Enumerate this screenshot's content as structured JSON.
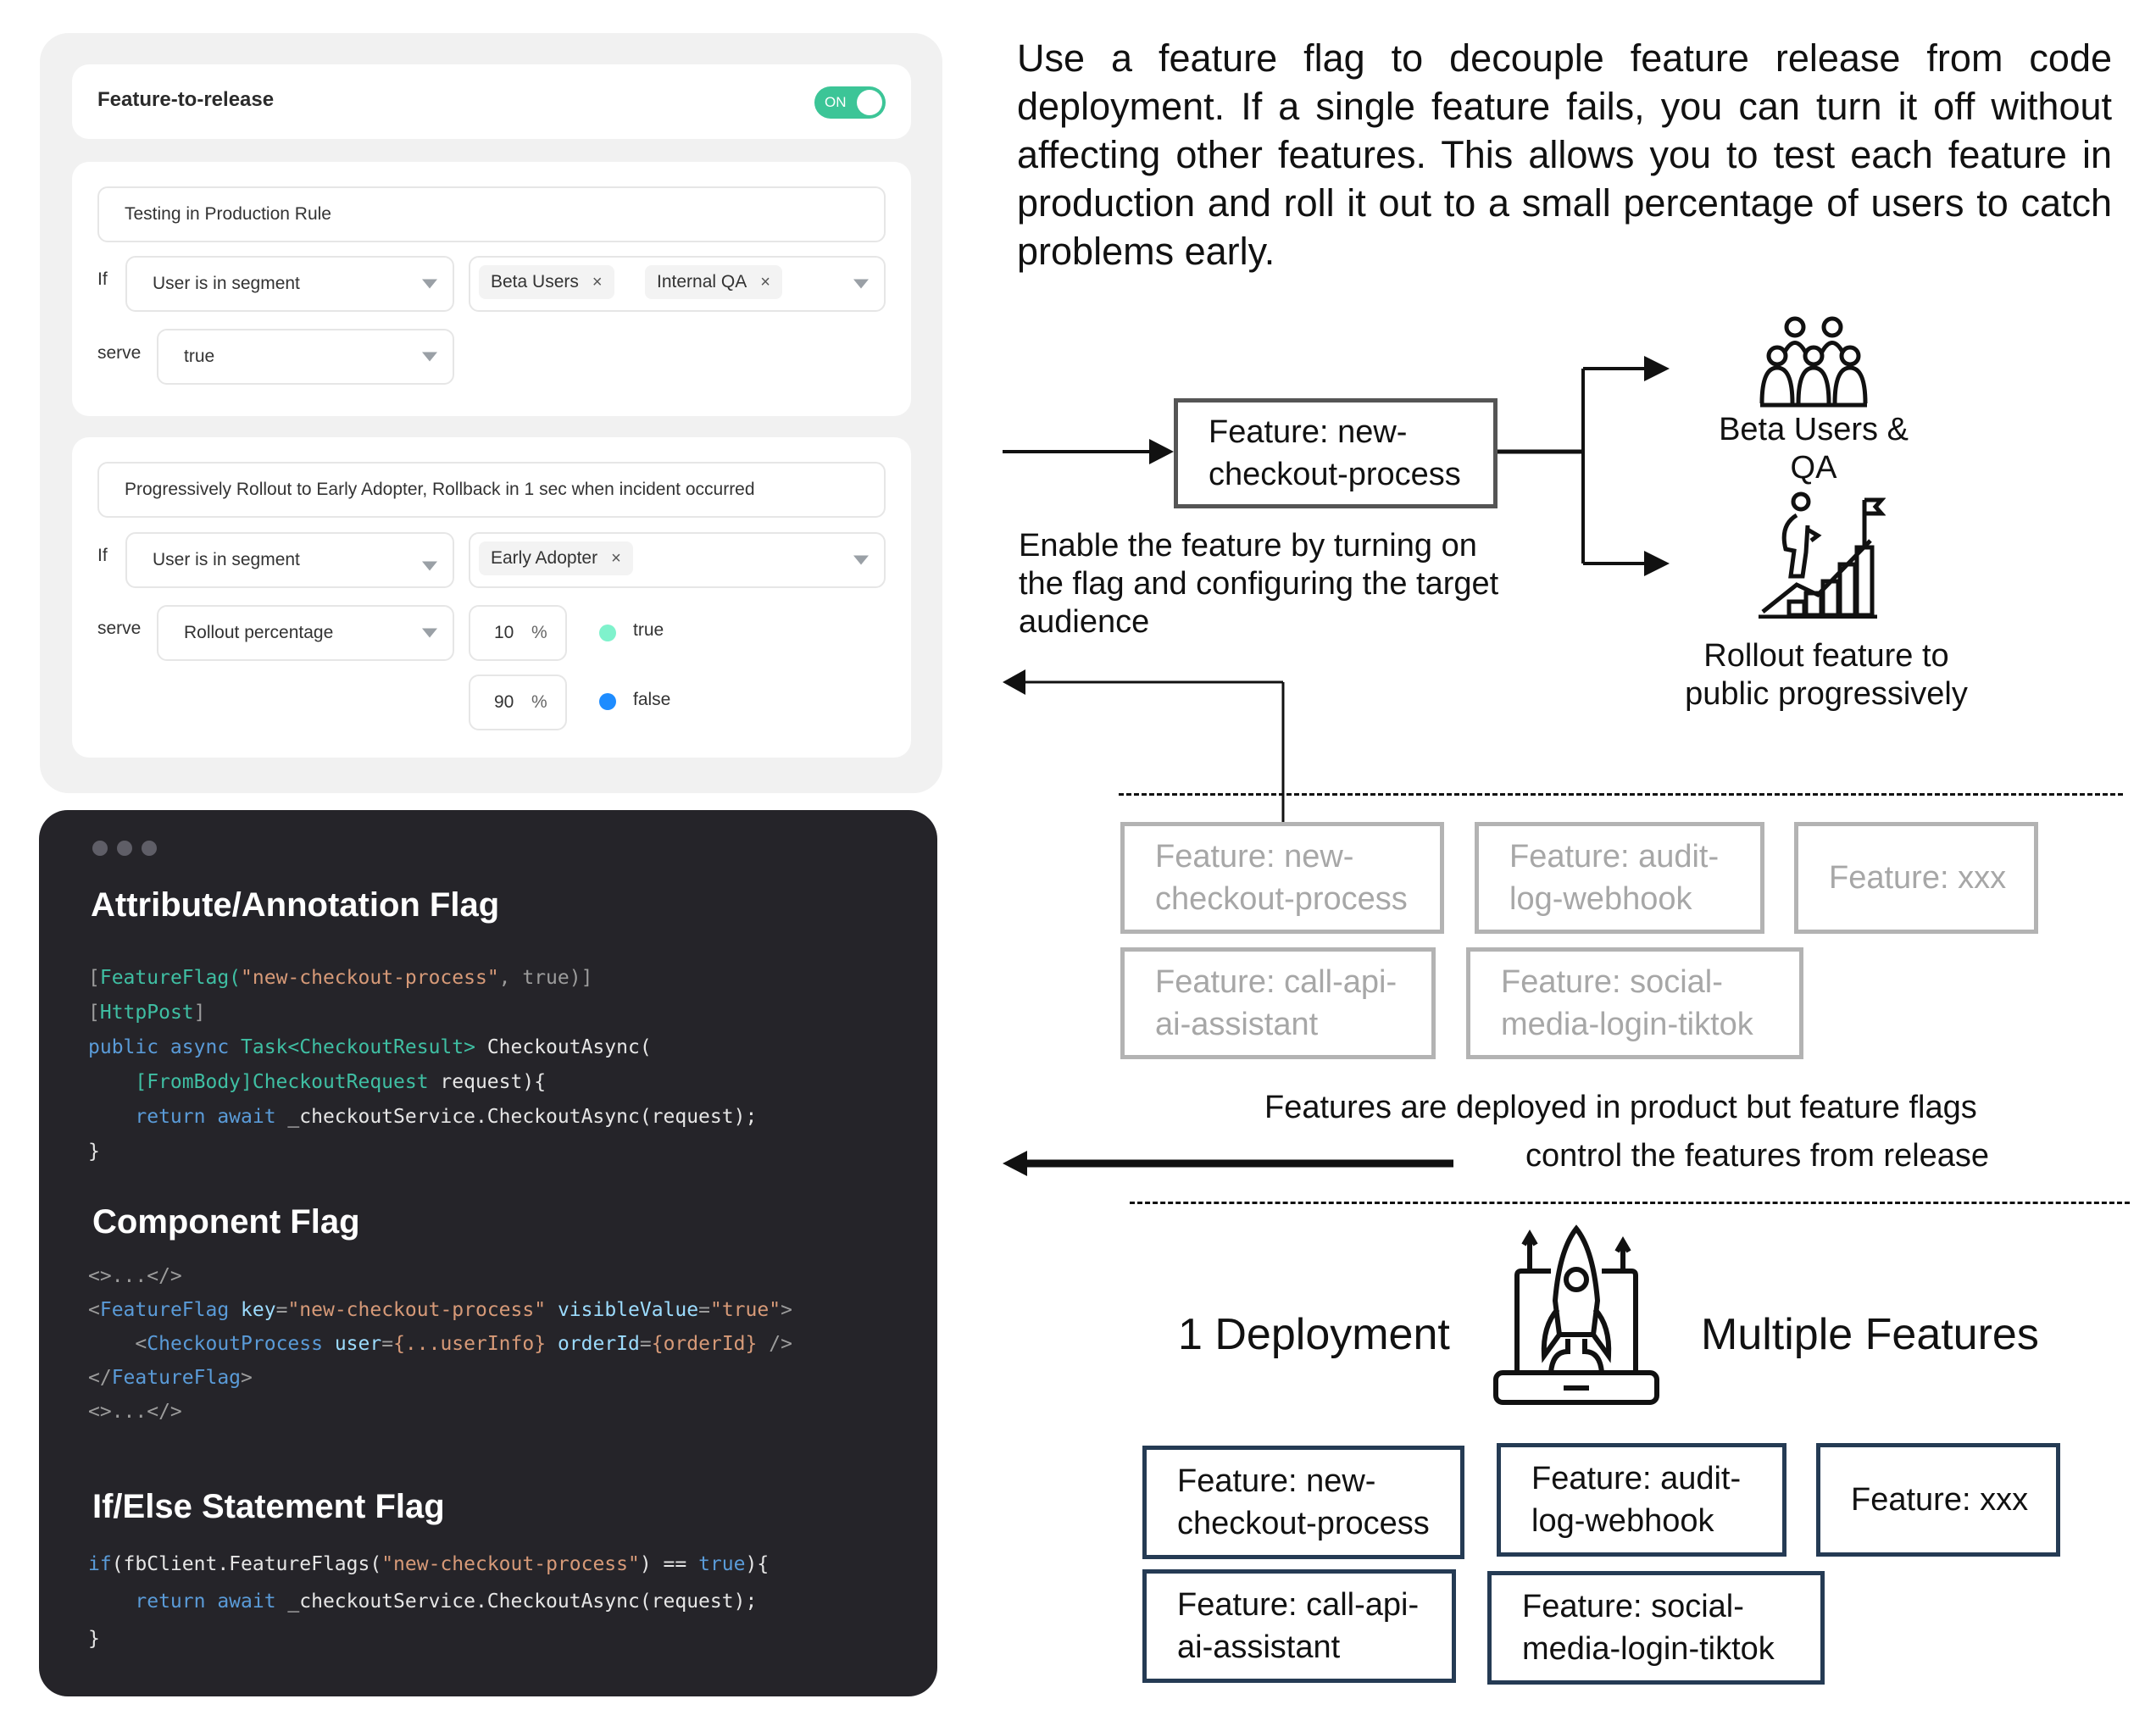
{
  "settings_panel": {
    "flag_name": "Feature-to-release",
    "toggle": {
      "label": "ON",
      "state": "on",
      "color": "#3cc597"
    },
    "rules": [
      {
        "name": "Testing in Production Rule",
        "if_label": "If",
        "condition": "User is in segment",
        "segments": [
          "Beta Users",
          "Internal QA"
        ],
        "serve_label": "serve",
        "serve_value": "true"
      },
      {
        "name": "Progressively Rollout to Early Adopter, Rollback in 1 sec when incident occurred",
        "if_label": "If",
        "condition": "User is in segment",
        "segments": [
          "Early Adopter"
        ],
        "serve_label": "serve",
        "serve_value": "Rollout percentage",
        "rollout": [
          {
            "percent": "10",
            "unit": "%",
            "variation": "true",
            "color": "#7ff2cc"
          },
          {
            "percent": "90",
            "unit": "%",
            "variation": "false",
            "color": "#1e8cff"
          }
        ]
      }
    ],
    "remove_glyph": "×"
  },
  "code_panel": {
    "sections": [
      {
        "title": "Attribute/Annotation Flag",
        "lines": [
          [
            [
              "g",
              "["
            ],
            [
              "t",
              "FeatureFlag("
            ],
            [
              "s",
              "\"new-checkout-process\""
            ],
            [
              "g",
              ", true)]"
            ]
          ],
          [
            [
              "g",
              "["
            ],
            [
              "t",
              "HttpPost"
            ],
            [
              "g",
              "]"
            ]
          ],
          [
            [
              "k",
              "public async "
            ],
            [
              "t",
              "Task<CheckoutResult> "
            ],
            [
              "w",
              "CheckoutAsync("
            ]
          ],
          [
            [
              "w",
              "    "
            ],
            [
              "t",
              "[FromBody]CheckoutRequest "
            ],
            [
              "w",
              "request){"
            ]
          ],
          [
            [
              "w",
              "    "
            ],
            [
              "k",
              "return await "
            ],
            [
              "w",
              "_checkoutService.CheckoutAsync(request);"
            ]
          ],
          [
            [
              "w",
              "}"
            ]
          ]
        ]
      },
      {
        "title": "Component Flag",
        "lines": [
          [
            [
              "g",
              "<>...</>"
            ]
          ],
          [
            [
              "g",
              "<"
            ],
            [
              "k",
              "FeatureFlag "
            ],
            [
              "a",
              "key"
            ],
            [
              "g",
              "="
            ],
            [
              "s",
              "\"new-checkout-process\" "
            ],
            [
              "a",
              "visibleValue"
            ],
            [
              "g",
              "="
            ],
            [
              "s",
              "\"true\""
            ],
            [
              "g",
              ">"
            ]
          ],
          [
            [
              "g",
              "    <"
            ],
            [
              "k",
              "CheckoutProcess "
            ],
            [
              "a",
              "user"
            ],
            [
              "g",
              "="
            ],
            [
              "s",
              "{...userInfo} "
            ],
            [
              "a",
              "orderId"
            ],
            [
              "g",
              "="
            ],
            [
              "s",
              "{orderId} "
            ],
            [
              "g",
              "/>"
            ]
          ],
          [
            [
              "g",
              "</"
            ],
            [
              "k",
              "FeatureFlag"
            ],
            [
              "g",
              ">"
            ]
          ],
          [
            [
              "g",
              "<>...</>"
            ]
          ]
        ]
      },
      {
        "title": "If/Else Statement Flag",
        "lines": [
          [
            [
              "k",
              "if"
            ],
            [
              "w",
              "(fbClient.FeatureFlags("
            ],
            [
              "s",
              "\"new-checkout-process\""
            ],
            [
              "w",
              ") == "
            ],
            [
              "k",
              "true"
            ],
            [
              "w",
              "){"
            ]
          ],
          [
            [
              "w",
              "    "
            ],
            [
              "k",
              "return await "
            ],
            [
              "w",
              "_checkoutService.CheckoutAsync(request);"
            ]
          ],
          [
            [
              "w",
              "}"
            ]
          ]
        ]
      }
    ]
  },
  "diagram": {
    "intro": "Use a feature flag to decouple feature release from code deployment. If a single feature fails, you can turn it off without affecting other features. This allows you to test each feature in production and roll it out to a small percentage of users to catch problems early.",
    "main_feature": "Feature: new-checkout-process",
    "enable_caption": "Enable the feature by turning on the flag and configuring the target audience",
    "targets": [
      {
        "label": "Beta Users & QA",
        "icon": "group-of-people-icon"
      },
      {
        "label": "Rollout feature to public progressively",
        "icon": "person-climbing-growth-chart-icon"
      }
    ],
    "deployed_features": [
      "Feature: new-checkout-process",
      "Feature: audit-log-webhook",
      "Feature: xxx",
      "Feature: call-api-ai-assistant",
      "Feature: social-media-login-tiktok"
    ],
    "deployed_caption_line1": "Features are deployed in product but feature flags",
    "deployed_caption_line2": "control the features from release",
    "deployment_label": "1 Deployment",
    "features_label": "Multiple Features",
    "deployment_icon": "rocket-launch-laptop-icon",
    "bottom_features": [
      "Feature: new-checkout-process",
      "Feature: audit-log-webhook",
      "Feature: xxx",
      "Feature: call-api-ai-assistant",
      "Feature: social-media-login-tiktok"
    ]
  }
}
